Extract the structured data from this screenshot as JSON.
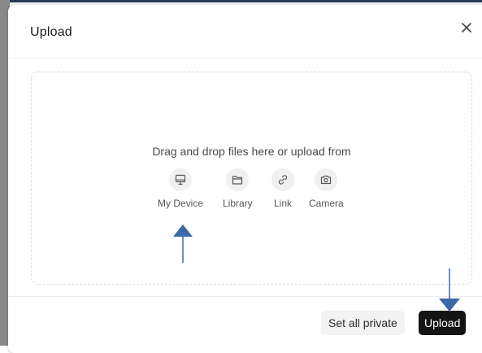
{
  "modal": {
    "title": "Upload",
    "close_label": "×"
  },
  "dropzone": {
    "instruction": "Drag and drop files here or upload from",
    "sources": [
      {
        "label": "My Device",
        "icon": "monitor-icon"
      },
      {
        "label": "Library",
        "icon": "folder-icon"
      },
      {
        "label": "Link",
        "icon": "link-icon"
      },
      {
        "label": "Camera",
        "icon": "camera-icon"
      }
    ]
  },
  "footer": {
    "set_private_label": "Set all private",
    "upload_label": "Upload"
  },
  "annotations": {
    "arrow_color": "#3b68a8"
  }
}
